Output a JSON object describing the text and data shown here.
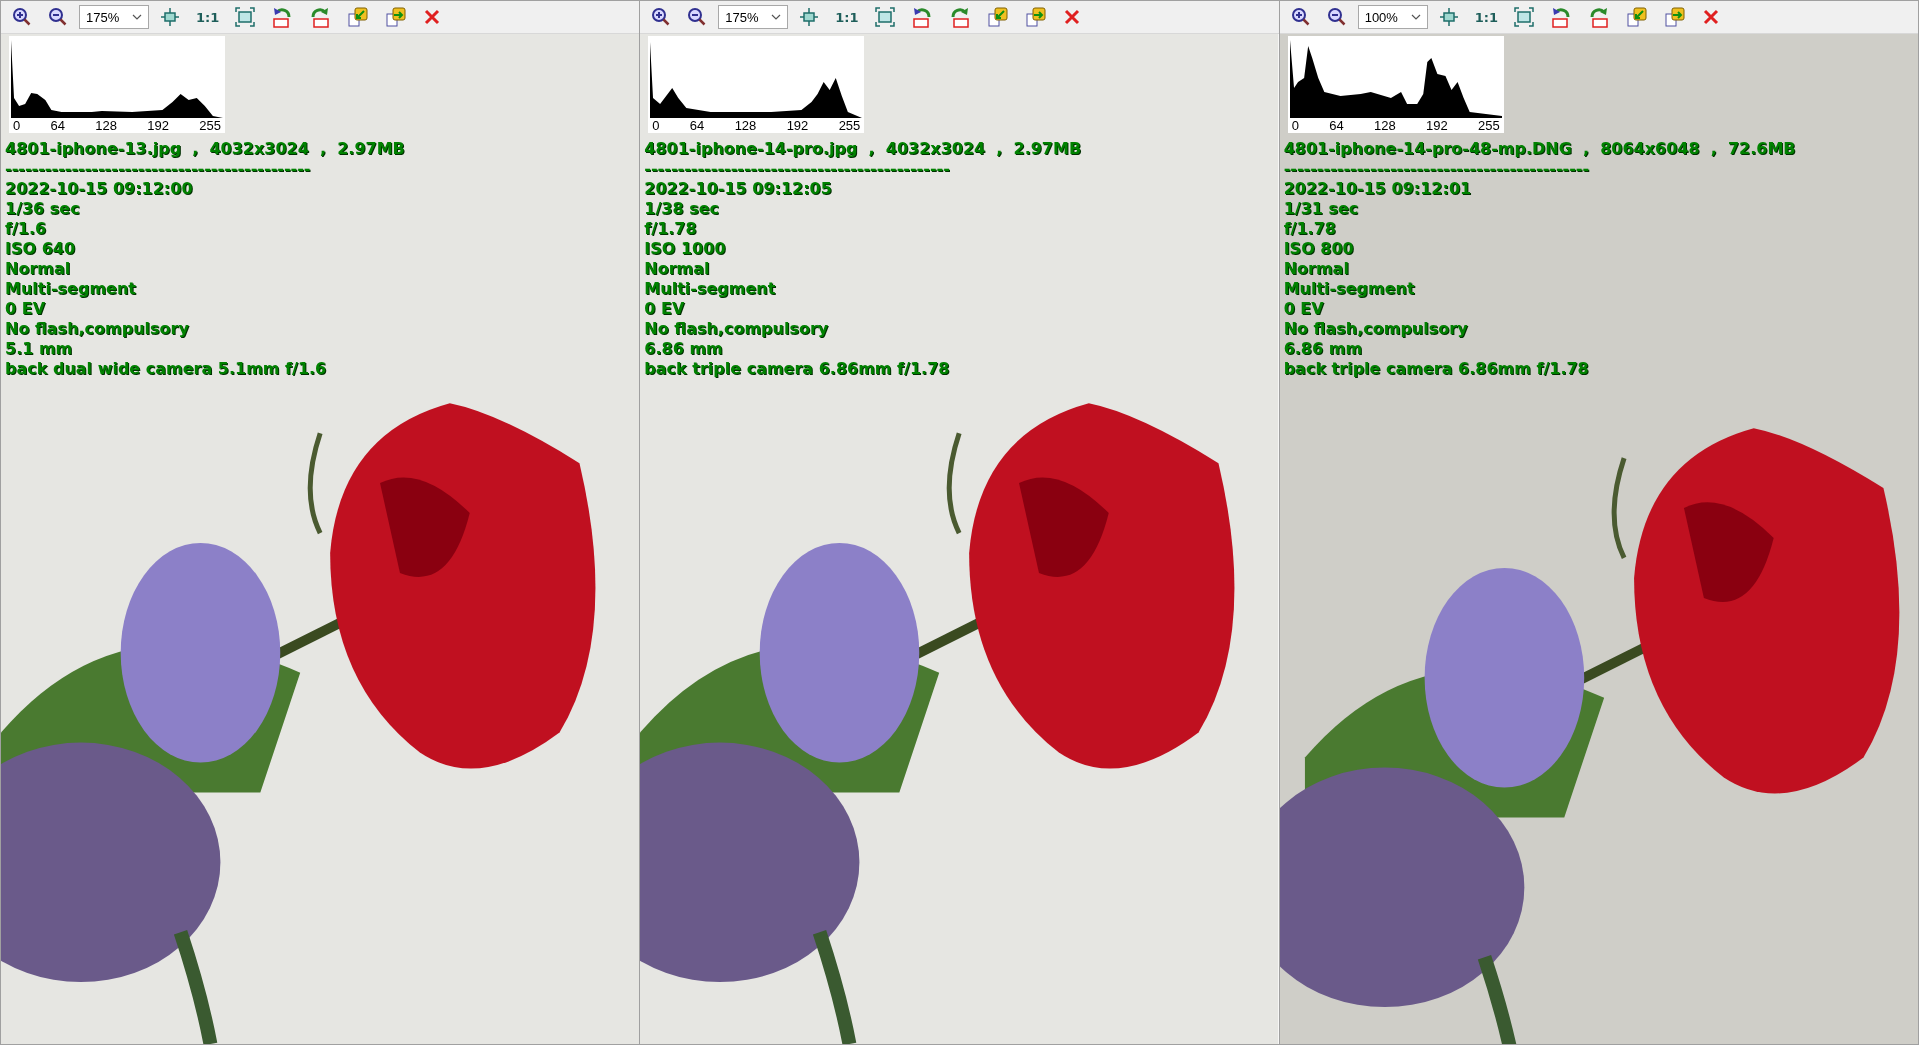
{
  "panels": [
    {
      "toolbar": {
        "zoom": "175%",
        "actual_size": "1:1"
      },
      "histogram": {
        "ticks": [
          "0",
          "64",
          "128",
          "192",
          "255"
        ]
      },
      "info": {
        "file": "4801-iphone-13.jpg  ,  4032x3024  ,  2.97MB",
        "separator": "----------------------------------------------",
        "lines": [
          "2022-10-15 09:12:00",
          "1/36 sec",
          "f/1.6",
          "ISO 640",
          "Normal",
          "Multi-segment",
          "0 EV",
          "No flash,compulsory",
          "5.1 mm",
          "back dual wide camera 5.1mm f/1.6"
        ]
      }
    },
    {
      "toolbar": {
        "zoom": "175%",
        "actual_size": "1:1"
      },
      "histogram": {
        "ticks": [
          "0",
          "64",
          "128",
          "192",
          "255"
        ]
      },
      "info": {
        "file": "4801-iphone-14-pro.jpg  ,  4032x3024  ,  2.97MB",
        "separator": "----------------------------------------------",
        "lines": [
          "2022-10-15 09:12:05",
          "1/38 sec",
          "f/1.78",
          "ISO 1000",
          "Normal",
          "Multi-segment",
          "0 EV",
          "No flash,compulsory",
          "6.86 mm",
          "back triple camera 6.86mm f/1.78"
        ]
      }
    },
    {
      "toolbar": {
        "zoom": "100%",
        "actual_size": "1:1"
      },
      "histogram": {
        "ticks": [
          "0",
          "64",
          "128",
          "192",
          "255"
        ]
      },
      "info": {
        "file": "4801-iphone-14-pro-48-mp.DNG  ,  8064x6048  ,  72.6MB",
        "separator": "----------------------------------------------",
        "lines": [
          "2022-10-15 09:12:01",
          "1/31 sec",
          "f/1.78",
          "ISO 800",
          "Normal",
          "Multi-segment",
          "0 EV",
          "No flash,compulsory",
          "6.86 mm",
          "back triple camera 6.86mm f/1.78"
        ]
      }
    }
  ]
}
